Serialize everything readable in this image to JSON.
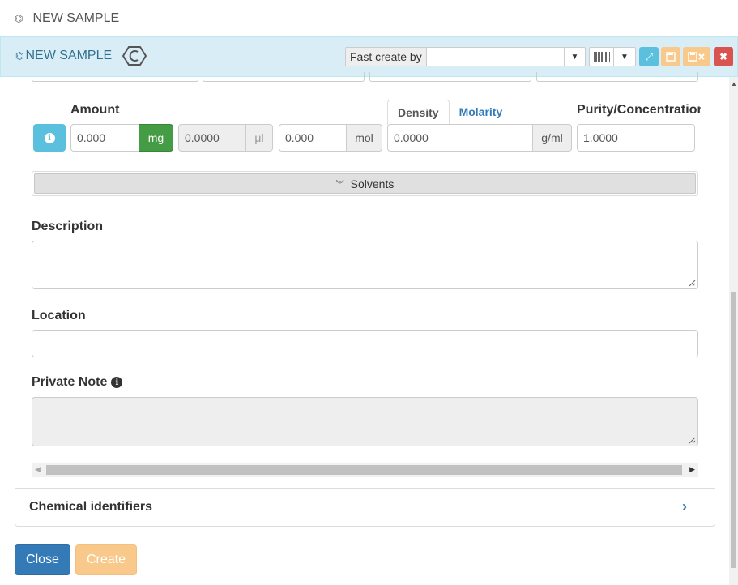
{
  "tab": {
    "label": "NEW SAMPLE",
    "icon": "molecule-icon"
  },
  "header": {
    "title": "NEW SAMPLE",
    "fast_create_label": "Fast create by",
    "fast_create_value": "",
    "colors": {
      "background": "#d9edf7",
      "title": "#31708f",
      "info": "#5bc0de",
      "warning": "#f0ad4e",
      "danger": "#d9534f"
    }
  },
  "amount": {
    "label": "Amount",
    "mass_value": "0.000",
    "mass_unit": "mg",
    "volume_value": "0.0000",
    "volume_unit": "μl",
    "mol_value": "0.000",
    "mol_unit": "mol"
  },
  "density_tabs": {
    "active": "Density",
    "other": "Molarity"
  },
  "density": {
    "value": "0.0000",
    "unit": "g/ml"
  },
  "purity": {
    "label": "Purity/Concentration",
    "value": "1.0000"
  },
  "solvents": {
    "label": "Solvents"
  },
  "description": {
    "label": "Description",
    "value": ""
  },
  "location": {
    "label": "Location",
    "value": ""
  },
  "private_note": {
    "label": "Private Note",
    "value": ""
  },
  "chemical_identifiers": {
    "label": "Chemical identifiers"
  },
  "buttons": {
    "close": "Close",
    "create": "Create"
  }
}
